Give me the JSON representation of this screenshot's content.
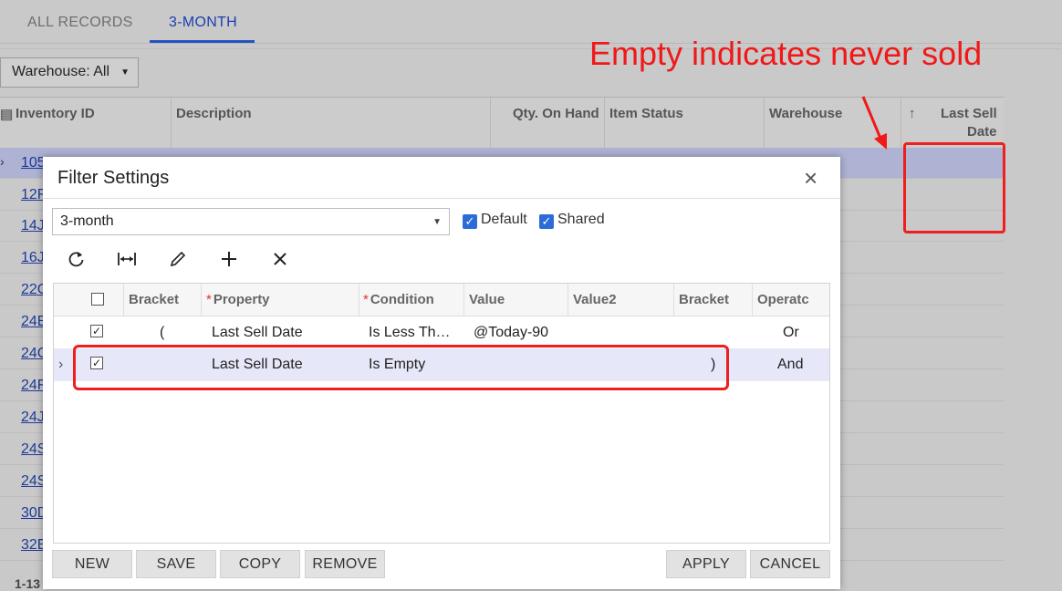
{
  "tabs": [
    {
      "label": "ALL RECORDS",
      "active": false
    },
    {
      "label": "3-MONTH",
      "active": true
    }
  ],
  "warehouse_select": {
    "value": "Warehouse: All"
  },
  "grid": {
    "columns": [
      "Inventory ID",
      "Description",
      "Qty. On Hand",
      "Item Status",
      "Warehouse",
      "↑",
      "Last Sell",
      "Date"
    ],
    "rows": [
      "105",
      "12F",
      "14J",
      "16J",
      "22C",
      "24E",
      "24C",
      "24F",
      "24J",
      "24S",
      "24S",
      "30D",
      "32E"
    ],
    "footer": "1-13"
  },
  "annotation": {
    "text": "Empty indicates never sold",
    "color": "#f01818"
  },
  "modal": {
    "title": "Filter Settings",
    "filter_name": "3-month",
    "default_label": "Default",
    "shared_label": "Shared",
    "default_checked": true,
    "shared_checked": true,
    "toolbar_icons": [
      "refresh-icon",
      "fit-columns-icon",
      "edit-icon",
      "add-icon",
      "delete-icon"
    ],
    "table": {
      "headers": {
        "bracket_open": "Bracket",
        "property": "Property",
        "condition": "Condition",
        "value": "Value",
        "value2": "Value2",
        "bracket_close": "Bracket",
        "operator": "Operatc"
      },
      "required_mark": "*",
      "rows": [
        {
          "checked": true,
          "bracket_open": "(",
          "property": "Last Sell Date",
          "condition": "Is Less Th…",
          "value": "@Today-90",
          "value2": "",
          "bracket_close": "",
          "operator": "Or"
        },
        {
          "checked": true,
          "bracket_open": "",
          "property": "Last Sell Date",
          "condition": "Is Empty",
          "value": "",
          "value2": "",
          "bracket_close": ")",
          "operator": "And"
        }
      ]
    },
    "buttons": {
      "new": "NEW",
      "save": "SAVE",
      "copy": "COPY",
      "remove": "REMOVE",
      "apply": "APPLY",
      "cancel": "CANCEL"
    }
  },
  "colors": {
    "accent": "#2452c6",
    "annotation": "#ee1f1f",
    "checkbox": "#2c6cd8",
    "selected_row": "#e6e7f8"
  }
}
